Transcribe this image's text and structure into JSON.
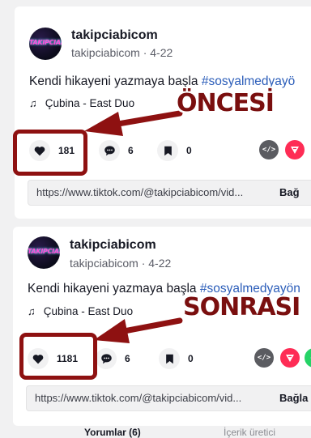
{
  "posts": [
    {
      "avatar_text": "TAKIPCIABI",
      "username": "takipciabicom",
      "meta": "takipciabicom · 4-22",
      "caption_text": "Kendi hikayeni yazmaya başla ",
      "caption_tag": "#sosyalmedyayö",
      "music": "Çubina - East Duo",
      "likes": "181",
      "comments": "6",
      "saves": "0",
      "url": "https://www.tiktok.com/@takipciabicom/vid...",
      "copy_label": "Bağ"
    },
    {
      "avatar_text": "TAKIPCIABI",
      "username": "takipciabicom",
      "meta": "takipciabicom · 4-22",
      "caption_text": "Kendi hikayeni yazmaya başla ",
      "caption_tag": "#sosyalmedyayön",
      "music": "Çubina - East Duo",
      "likes": "1181",
      "comments": "6",
      "saves": "0",
      "url": "https://www.tiktok.com/@takipciabicom/vid...",
      "copy_label": "Bağla"
    }
  ],
  "annotations": {
    "before": "ÖNCESİ",
    "after": "SONRASI"
  },
  "tabs": {
    "comments": "Yorumlar (6)",
    "creator": "İçerik üretici"
  },
  "colors": {
    "highlight": "#8e1111",
    "hashtag": "#2b5db9",
    "tiktok_red": "#fe2c55",
    "whatsapp": "#25d366"
  },
  "icons": [
    "heart-icon",
    "comment-icon",
    "bookmark-icon",
    "embed-icon",
    "send-icon",
    "whatsapp-icon",
    "music-note-icon"
  ]
}
